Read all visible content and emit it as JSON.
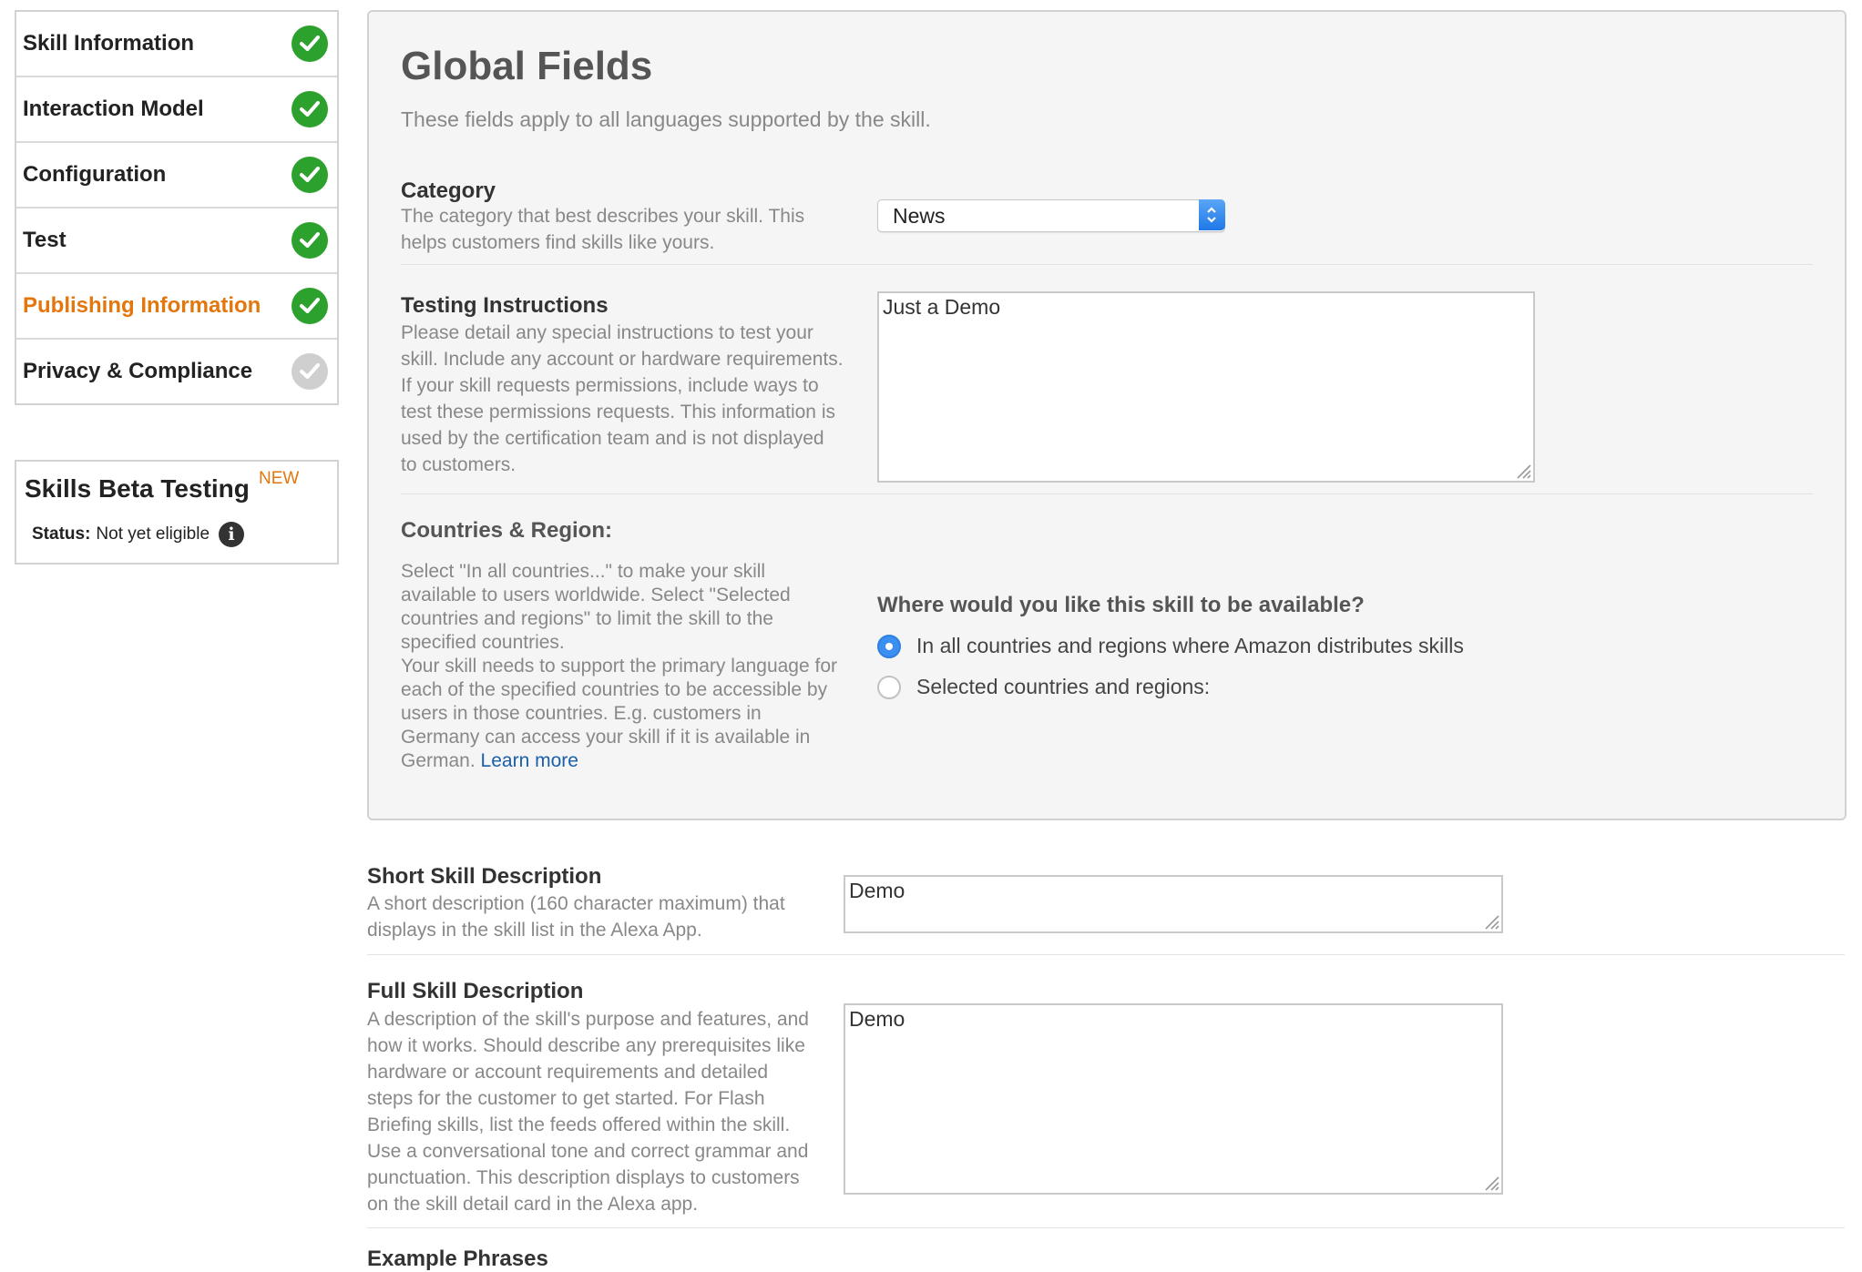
{
  "sidebar": {
    "items": [
      {
        "label": "Skill Information",
        "status": "complete"
      },
      {
        "label": "Interaction Model",
        "status": "complete"
      },
      {
        "label": "Configuration",
        "status": "complete"
      },
      {
        "label": "Test",
        "status": "complete"
      },
      {
        "label": "Publishing Information",
        "status": "complete",
        "active": true
      },
      {
        "label": "Privacy & Compliance",
        "status": "incomplete"
      }
    ],
    "beta": {
      "title": "Skills Beta Testing",
      "badge": "NEW",
      "status_label": "Status:",
      "status_value": "Not yet eligible",
      "info_glyph": "i"
    }
  },
  "global": {
    "title": "Global Fields",
    "subtitle": "These fields apply to all languages supported by the skill.",
    "category": {
      "label": "Category",
      "desc1": "The category that best describes your skill. This",
      "desc2": "helps customers find skills like yours.",
      "value": "News"
    },
    "testing": {
      "label": "Testing Instructions",
      "desc": [
        "Please detail any special instructions to test your",
        "skill. Include any account or hardware requirements.",
        "If your skill requests permissions, include ways to",
        "test these permissions requests. This information is",
        "used by the certification team and is not displayed",
        "to customers."
      ],
      "value": "Just a Demo"
    },
    "countries": {
      "label": "Countries & Region:",
      "desc": [
        "Select \"In all countries...\" to make your skill",
        "available to users worldwide. Select \"Selected",
        "countries and regions\" to limit the skill to the",
        "specified countries.",
        "Your skill needs to support the primary language for",
        "each of the specified countries to be accessible by",
        "users in those countries. E.g. customers in",
        "Germany can access your skill if it is available in",
        "German."
      ],
      "learn_more": "Learn more",
      "question": "Where would you like this skill to be available?",
      "option_all": "In all countries and regions where Amazon distributes skills",
      "option_selected": "Selected countries and regions:",
      "selected_option": "all"
    }
  },
  "short_desc": {
    "label": "Short Skill Description",
    "desc1": "A short description (160 character maximum) that",
    "desc2": "displays in the skill list in the Alexa App.",
    "value": "Demo"
  },
  "full_desc": {
    "label": "Full Skill Description",
    "desc": [
      "A description of the skill's purpose and features, and",
      "how it works. Should describe any prerequisites like",
      "hardware or account requirements and detailed",
      "steps for the customer to get started. For Flash",
      "Briefing skills, list the feeds offered within the skill.",
      "Use a conversational tone and correct grammar and",
      "punctuation. This description displays to customers",
      "on the skill detail card in the Alexa app."
    ],
    "value": "Demo"
  },
  "example_phrases": {
    "label": "Example Phrases"
  },
  "colors": {
    "active": "#e4760e",
    "check_green": "#2da12d",
    "check_grey": "#cfcfcf",
    "link": "#1a5fa8",
    "radio_on": "#3a8ff0"
  },
  "icons": [
    "check-circle-icon",
    "info-icon",
    "select-arrows-icon",
    "resize-grip-icon"
  ]
}
